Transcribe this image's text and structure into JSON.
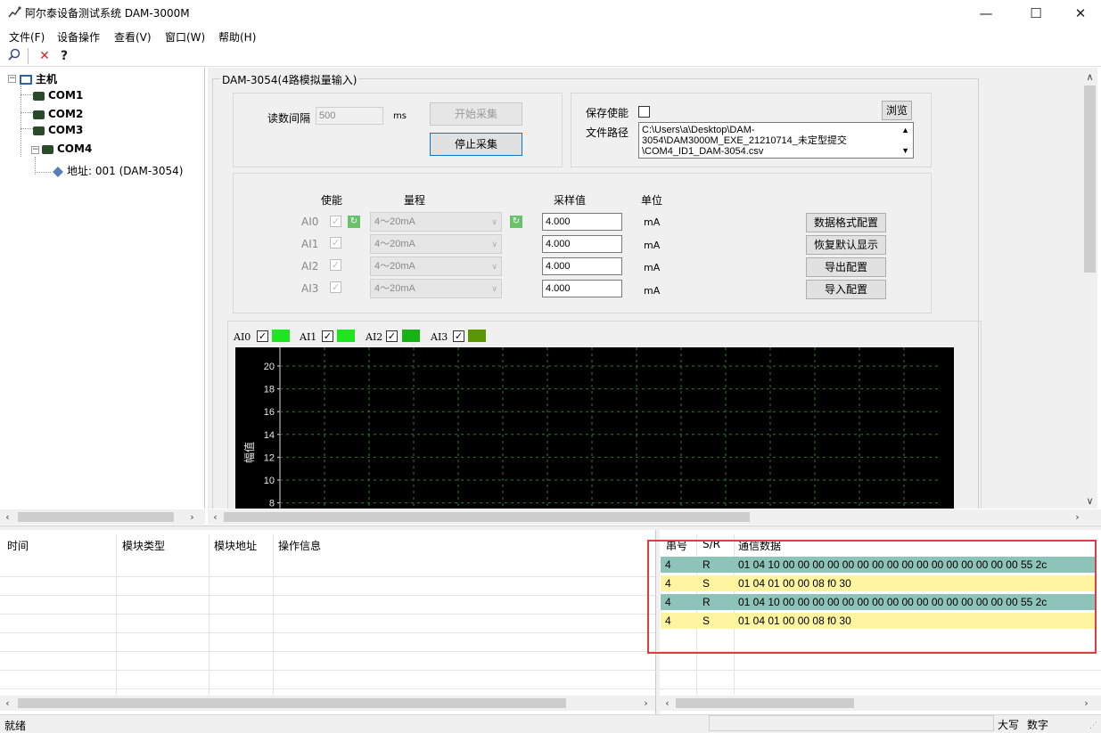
{
  "window": {
    "title": "阿尔泰设备测试系统 DAM-3000M",
    "controls": {
      "minimize": "—",
      "maximize": "☐",
      "close": "✕"
    }
  },
  "menu": {
    "items": [
      "文件(F)",
      "设备操作",
      "查看(V)",
      "窗口(W)",
      "帮助(H)"
    ]
  },
  "toolbar": {
    "search_glyph": "⌕",
    "delete_glyph": "✕",
    "help_glyph": "?"
  },
  "tree": {
    "root_label": "主机",
    "ports": [
      "COM1",
      "COM2",
      "COM3",
      "COM4"
    ],
    "device_label": "地址: 001 (DAM-3054)"
  },
  "panel": {
    "title": "DAM-3054(4路模拟量输入)",
    "read_interval_label": "读数间隔",
    "read_interval_value": "500",
    "read_interval_unit": "ms",
    "start_button": "开始采集",
    "stop_button": "停止采集",
    "save_enable_label": "保存使能",
    "browse_button": "浏览",
    "file_path_label": "文件路径",
    "file_path_value": "C:\\Users\\a\\Desktop\\DAM-3054\\DAM3000M_EXE_21210714_未定型提交\\COM4_ID1_DAM-3054.csv"
  },
  "channels": {
    "headers": {
      "enable": "使能",
      "range": "量程",
      "sample": "采样值",
      "unit": "单位"
    },
    "rows": [
      {
        "name": "AI0",
        "range": "4～20mA",
        "value": "4.000",
        "unit": "mA"
      },
      {
        "name": "AI1",
        "range": "4～20mA",
        "value": "4.000",
        "unit": "mA"
      },
      {
        "name": "AI2",
        "range": "4～20mA",
        "value": "4.000",
        "unit": "mA"
      },
      {
        "name": "AI3",
        "range": "4～20mA",
        "value": "4.000",
        "unit": "mA"
      }
    ],
    "buttons": {
      "data_format": "数据格式配置",
      "restore_default": "恢复默认显示",
      "export_config": "导出配置",
      "import_config": "导入配置"
    }
  },
  "legend": [
    {
      "name": "AI0",
      "color": "#1ee61e"
    },
    {
      "name": "AI1",
      "color": "#1ee61e"
    },
    {
      "name": "AI2",
      "color": "#14b414"
    },
    {
      "name": "AI3",
      "color": "#5a9600"
    }
  ],
  "chart_data": {
    "type": "line",
    "ylabel": "幅值",
    "y_ticks": [
      "20",
      "18",
      "16",
      "14",
      "12",
      "10",
      "8"
    ],
    "ylim": [
      8,
      20
    ],
    "grid": true,
    "background": "#000000",
    "grid_color": "#2f7a2f",
    "series": []
  },
  "log_table": {
    "headers": [
      "时间",
      "模块类型",
      "模块地址",
      "操作信息"
    ]
  },
  "comm_table": {
    "headers": [
      "串号",
      "S/R",
      "通信数据"
    ],
    "rows": [
      {
        "port": "4",
        "dir": "R",
        "data": "01 04 10 00 00 00 00 00 00 00 00 00 00 00 00 00 00 00 00 55 2c"
      },
      {
        "port": "4",
        "dir": "S",
        "data": "01 04 01 00 00 08 f0 30"
      },
      {
        "port": "4",
        "dir": "R",
        "data": "01 04 10 00 00 00 00 00 00 00 00 00 00 00 00 00 00 00 00 55 2c"
      },
      {
        "port": "4",
        "dir": "S",
        "data": "01 04 01 00 00 08 f0 30"
      }
    ]
  },
  "highlight_color": "#e03c3c",
  "statusbar": {
    "ready": "就绪",
    "caps": "大写",
    "num": "数字"
  }
}
